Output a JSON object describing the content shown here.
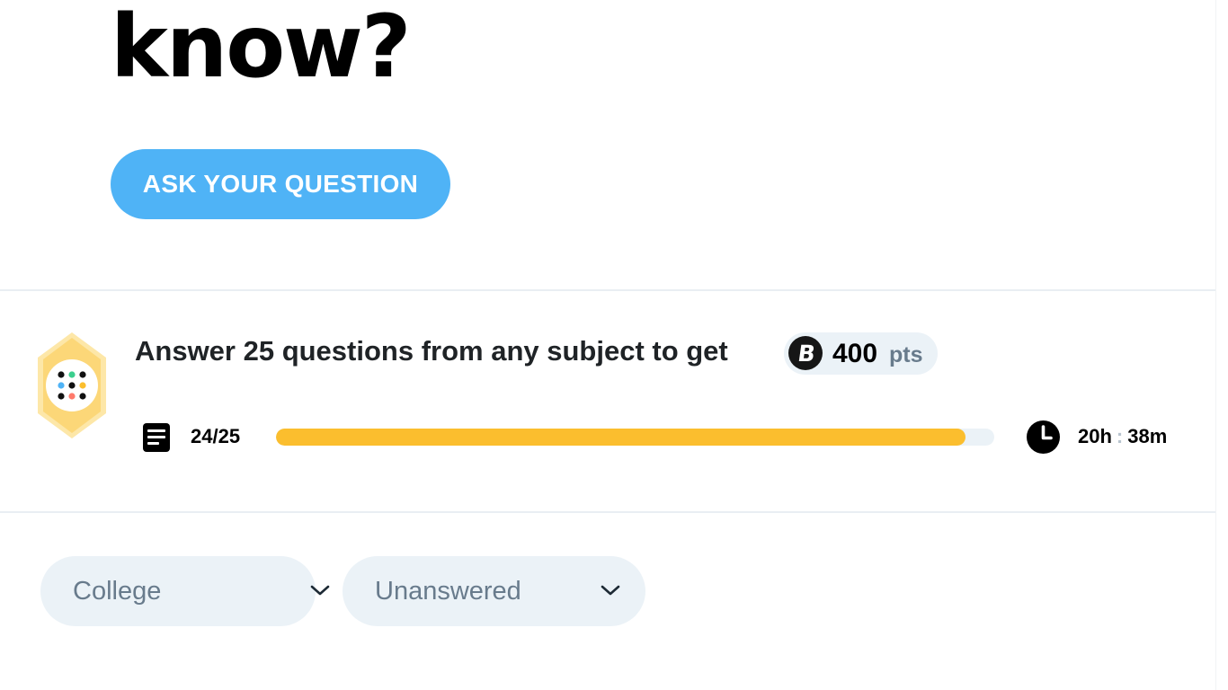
{
  "hero": {
    "title": "What do you need to\nknow?"
  },
  "ask_button": {
    "label": "ASK YOUR QUESTION"
  },
  "challenge": {
    "text": "Answer 25 questions from any subject to get",
    "points_value": "400",
    "points_unit": "pts",
    "coin_letter": "B",
    "progress_count": "24/25",
    "progress_fraction": 0.96,
    "timer_hours": "20h",
    "timer_sep": ":",
    "timer_minutes": "38m"
  },
  "filters": {
    "level": {
      "selected": "College"
    },
    "status": {
      "selected": "Unanswered"
    }
  },
  "colors": {
    "accent_blue": "#4fb3f6",
    "progress_yellow": "#fbbe2e",
    "pill_bg": "#ebf2f7",
    "muted_text": "#687b8c"
  },
  "icons": [
    "book-document-icon",
    "clock-icon",
    "coin-icon",
    "subject-grid-badge-icon",
    "chevron-down-icon"
  ]
}
